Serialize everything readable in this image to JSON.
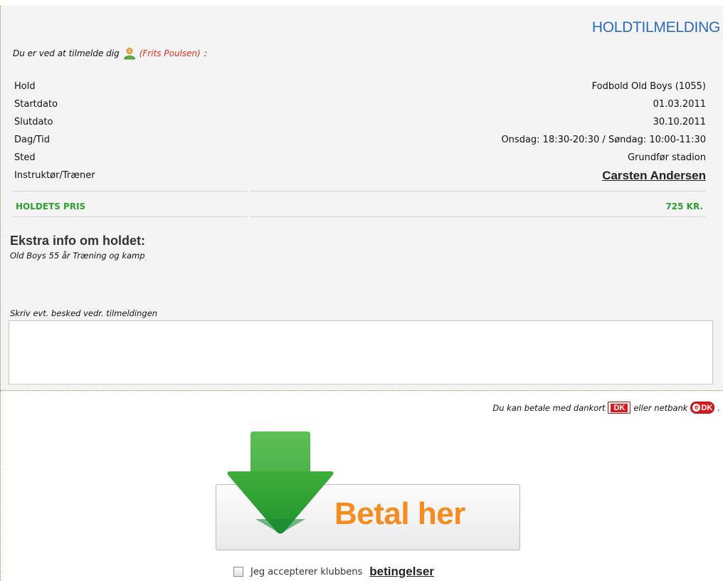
{
  "header": {
    "title": "HOLDTILMELDING",
    "intro_text": "Du er ved at tilmelde dig",
    "user_name": "(Frits Poulsen)",
    "intro_suffix": ":"
  },
  "details": [
    {
      "label": "Hold",
      "value": "Fodbold Old Boys (1055)"
    },
    {
      "label": "Startdato",
      "value": "01.03.2011"
    },
    {
      "label": "Slutdato",
      "value": "30.10.2011"
    },
    {
      "label": "Dag/Tid",
      "value": "Onsdag: 18:30-20:30 / Søndag: 10:00-11:30"
    },
    {
      "label": "Sted",
      "value": "Grundfør stadion"
    },
    {
      "label": "Instruktør/Træner",
      "value": "Carsten Andersen"
    }
  ],
  "price": {
    "label": "HOLDETS PRIS",
    "value": "725 KR."
  },
  "extra": {
    "title": "Ekstra info om holdet:",
    "text": "Old Boys 55 år Træning og kamp"
  },
  "message": {
    "label": "Skriv evt. besked vedr. tilmeldingen",
    "value": ""
  },
  "payment": {
    "note_prefix": "Du kan betale med dankort",
    "dk_badge": "DK",
    "note_middle": "eller netbank",
    "edk_e": "e",
    "edk_badge": "DK",
    "note_suffix": ".",
    "button_label": "Betal her"
  },
  "terms": {
    "text": "Jeg accepterer klubbens",
    "link": "betingelser",
    "checked": false
  },
  "colors": {
    "title": "#2a6bbd",
    "user_name": "#e0301e",
    "price": "#2ca12c",
    "pay_label": "#f58c1f",
    "arrow": "#3da83a"
  }
}
